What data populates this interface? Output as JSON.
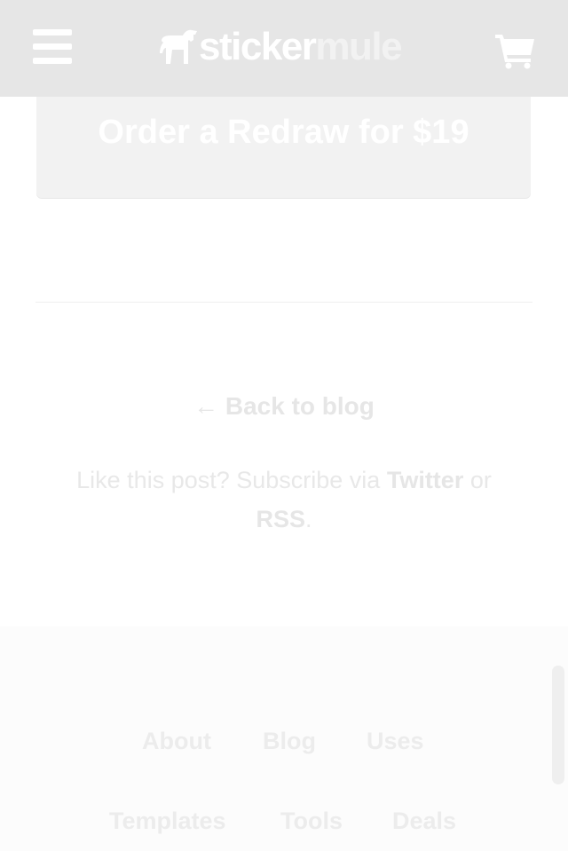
{
  "header": {
    "logo_part1": "sticker",
    "logo_part2": "mule"
  },
  "order_button": {
    "label": "Order a Redraw for $19"
  },
  "back_link": {
    "arrow": "←",
    "label": "Back to blog"
  },
  "subscribe": {
    "prefix": "Like this post? Subscribe via ",
    "twitter": "Twitter",
    "middle": " or",
    "rss": "RSS",
    "suffix": "."
  },
  "footer": {
    "links": [
      "About",
      "Blog",
      "Uses",
      "Templates",
      "Tools",
      "Deals"
    ]
  },
  "colors": {
    "header_bg": "#e6e6e6",
    "button_bg": "#f2f2f2",
    "footer_bg": "#fcfcfc"
  },
  "icons": [
    "menu-icon",
    "mule-logo-icon",
    "cart-icon"
  ]
}
